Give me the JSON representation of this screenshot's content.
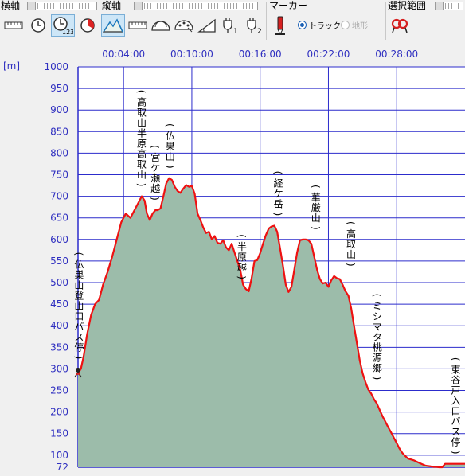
{
  "toolbar": {
    "x_axis_label": "横軸",
    "y_axis_label": "縦軸",
    "marker_label": "マーカー",
    "selection_label": "選択範囲",
    "marker_options": [
      {
        "label": "トラック",
        "selected": true,
        "enabled": true
      },
      {
        "label": "地形",
        "selected": false,
        "enabled": false
      }
    ],
    "buttons_x": [
      {
        "icon": "distance-ruler-icon"
      },
      {
        "icon": "clock-icon"
      },
      {
        "icon": "elapsed-time-123-icon",
        "active": true
      },
      {
        "icon": "pie-time-icon"
      }
    ],
    "buttons_y": [
      {
        "icon": "elevation-mountain-icon",
        "active": true
      },
      {
        "icon": "ruler-icon"
      },
      {
        "icon": "gauge-icon"
      },
      {
        "icon": "gauge-dots-icon"
      },
      {
        "icon": "slope-triangle-icon"
      },
      {
        "icon": "power-plug-1-icon",
        "sub": "1"
      },
      {
        "icon": "power-plug-2-icon",
        "sub": "2"
      }
    ],
    "marker_icon": "red-marker-icon",
    "selection_icon": "selection-loop-icon"
  },
  "colors": {
    "line": "#ee1111",
    "fill": "#9cbcaa",
    "grid": "#2c2ccc",
    "axis_text": "#3030c0",
    "plot_bg": "#ffffff"
  },
  "chart_data": {
    "type": "area",
    "ylabel": "[m]",
    "xlabel": "",
    "y_ticks": [
      72,
      100,
      150,
      200,
      250,
      300,
      350,
      400,
      450,
      500,
      550,
      600,
      650,
      700,
      750,
      800,
      850,
      900,
      950,
      1000
    ],
    "y_gridlines": [
      100,
      150,
      200,
      250,
      300,
      350,
      400,
      450,
      500,
      550,
      600,
      650,
      700,
      750,
      800,
      850,
      900,
      950,
      1000
    ],
    "ylim": [
      72,
      1000
    ],
    "x_ticks": [
      "00:04:00",
      "00:10:00",
      "00:16:00",
      "00:22:00",
      "00:28:00"
    ],
    "x_tick_minutes": [
      4,
      10,
      16,
      22,
      28
    ],
    "xlim_minutes": [
      0,
      34
    ],
    "series": [
      {
        "x_minutes": [
          0,
          0.25,
          0.5,
          0.8,
          1.15,
          1.5,
          1.85,
          2.2,
          2.6,
          3.0,
          3.4,
          3.8,
          4.2,
          4.6,
          5.0,
          5.3,
          5.6,
          5.85,
          6.05,
          6.3,
          6.55,
          6.8,
          7.0,
          7.25,
          7.5,
          7.75,
          8.0,
          8.25,
          8.5,
          8.75,
          9.0,
          9.2,
          9.5,
          9.75,
          10.0,
          10.25,
          10.5,
          10.75,
          11.0,
          11.25,
          11.5,
          11.75,
          12.0,
          12.25,
          12.5,
          12.75,
          13.0,
          13.25,
          13.5,
          13.75,
          14.0,
          14.25,
          14.5,
          14.75,
          15.0,
          15.25,
          15.5,
          15.75,
          16.0,
          16.25,
          16.5,
          16.75,
          17.0,
          17.25,
          17.5,
          17.75,
          18.0,
          18.25,
          18.5,
          18.75,
          19.0,
          19.25,
          19.5,
          19.75,
          20.0,
          20.25,
          20.5,
          20.75,
          21.0,
          21.25,
          21.5,
          21.75,
          22.0,
          22.25,
          22.5,
          22.75,
          23.0,
          23.25,
          23.5,
          23.75,
          24.0,
          24.25,
          24.5,
          24.75,
          25.0,
          25.25,
          25.5,
          25.75,
          26.0,
          26.25,
          26.5,
          26.75,
          27.0,
          27.25,
          27.5,
          27.75,
          28.0,
          28.25,
          28.5,
          28.75,
          29.0,
          29.25,
          29.5,
          29.75,
          30.0,
          30.25,
          30.5,
          30.75,
          31.0,
          31.25,
          31.5,
          31.75,
          32.0,
          32.25,
          32.5,
          32.75,
          33.0,
          33.25,
          33.5,
          33.75,
          34.0
        ],
        "values": [
          290,
          300,
          330,
          380,
          425,
          450,
          460,
          495,
          525,
          560,
          600,
          640,
          660,
          650,
          670,
          685,
          700,
          690,
          660,
          645,
          660,
          668,
          668,
          672,
          700,
          730,
          742,
          738,
          722,
          712,
          708,
          716,
          726,
          722,
          724,
          706,
          660,
          645,
          628,
          615,
          618,
          600,
          608,
          592,
          590,
          598,
          582,
          575,
          590,
          570,
          550,
          530,
          495,
          485,
          480,
          510,
          550,
          552,
          568,
          590,
          610,
          625,
          630,
          632,
          618,
          580,
          540,
          495,
          478,
          490,
          530,
          570,
          598,
          600,
          600,
          598,
          590,
          560,
          530,
          508,
          498,
          500,
          490,
          505,
          515,
          510,
          508,
          495,
          480,
          470,
          440,
          400,
          360,
          320,
          290,
          270,
          252,
          243,
          230,
          220,
          205,
          190,
          178,
          165,
          153,
          140,
          128,
          115,
          105,
          98,
          92,
          90,
          88,
          85,
          82,
          79,
          76,
          75,
          74,
          73,
          73,
          72,
          72,
          80,
          80,
          80,
          80,
          80,
          80,
          80,
          80,
          80,
          80
        ]
      }
    ],
    "annotations": [
      {
        "text": "仏巣山登山口バス停",
        "x_minutes": 0.1,
        "y": 300
      },
      {
        "text": "高取山半原高取山",
        "x_minutes": 5.6,
        "y": 700
      },
      {
        "text": "宮ケ瀬越",
        "x_minutes": 6.8,
        "y": 668
      },
      {
        "text": "仏果山",
        "x_minutes": 8.1,
        "y": 742
      },
      {
        "text": "半原越",
        "x_minutes": 14.4,
        "y": 485
      },
      {
        "text": "経ケ岳",
        "x_minutes": 17.6,
        "y": 632
      },
      {
        "text": "華厳山",
        "x_minutes": 20.9,
        "y": 600
      },
      {
        "text": "高取山",
        "x_minutes": 24.0,
        "y": 515
      },
      {
        "text": "ミシマタ桃源郷",
        "x_minutes": 26.3,
        "y": 252
      },
      {
        "text": "東谷戸入口バス停",
        "x_minutes": 33.2,
        "y": 80
      }
    ]
  }
}
